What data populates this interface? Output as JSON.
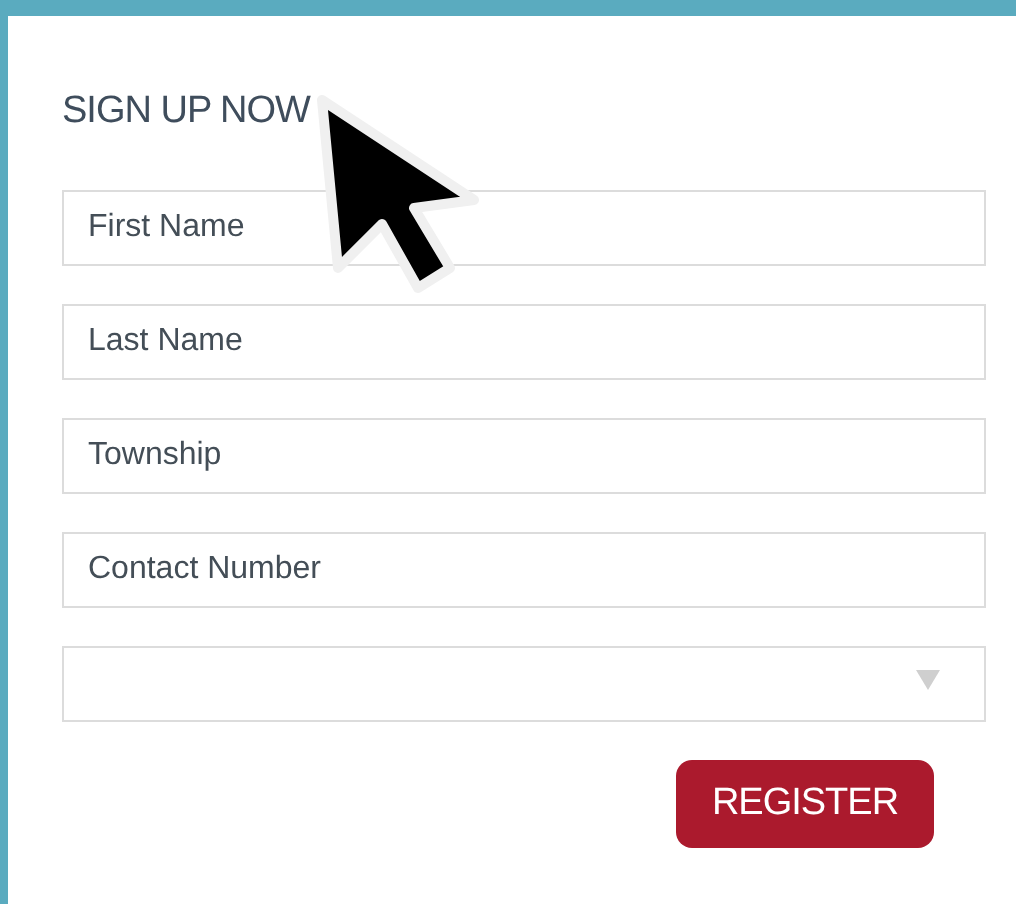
{
  "form": {
    "title": "SIGN UP NOW",
    "fields": [
      {
        "kind": "text",
        "placeholder": "First Name"
      },
      {
        "kind": "text",
        "placeholder": "Last Name"
      },
      {
        "kind": "text",
        "placeholder": "Township"
      },
      {
        "kind": "text",
        "placeholder": "Contact Number"
      },
      {
        "kind": "select"
      }
    ],
    "button": "REGISTER"
  }
}
